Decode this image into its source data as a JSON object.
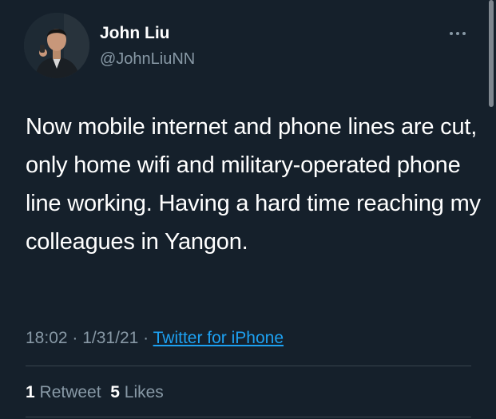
{
  "author": {
    "display_name": "John Liu",
    "handle": "@JohnLiuNN"
  },
  "tweet": {
    "text": "Now mobile internet and phone lines are cut, only home wifi and military-operated phone line working. Having a hard time reaching my colleagues in Yangon."
  },
  "meta": {
    "time": "18:02",
    "separator_1": " · ",
    "date": "1/31/21",
    "separator_2": " · ",
    "source": "Twitter for iPhone"
  },
  "stats": {
    "retweet_count": "1",
    "retweet_label": "Retweet",
    "like_count": "5",
    "like_label": "Likes"
  },
  "icons": {
    "more": "more-horizontal-icon"
  },
  "colors": {
    "background": "#15202b",
    "text_primary": "#ffffff",
    "text_secondary": "#8899a6",
    "link": "#1da1f2",
    "divider": "#38444d"
  }
}
